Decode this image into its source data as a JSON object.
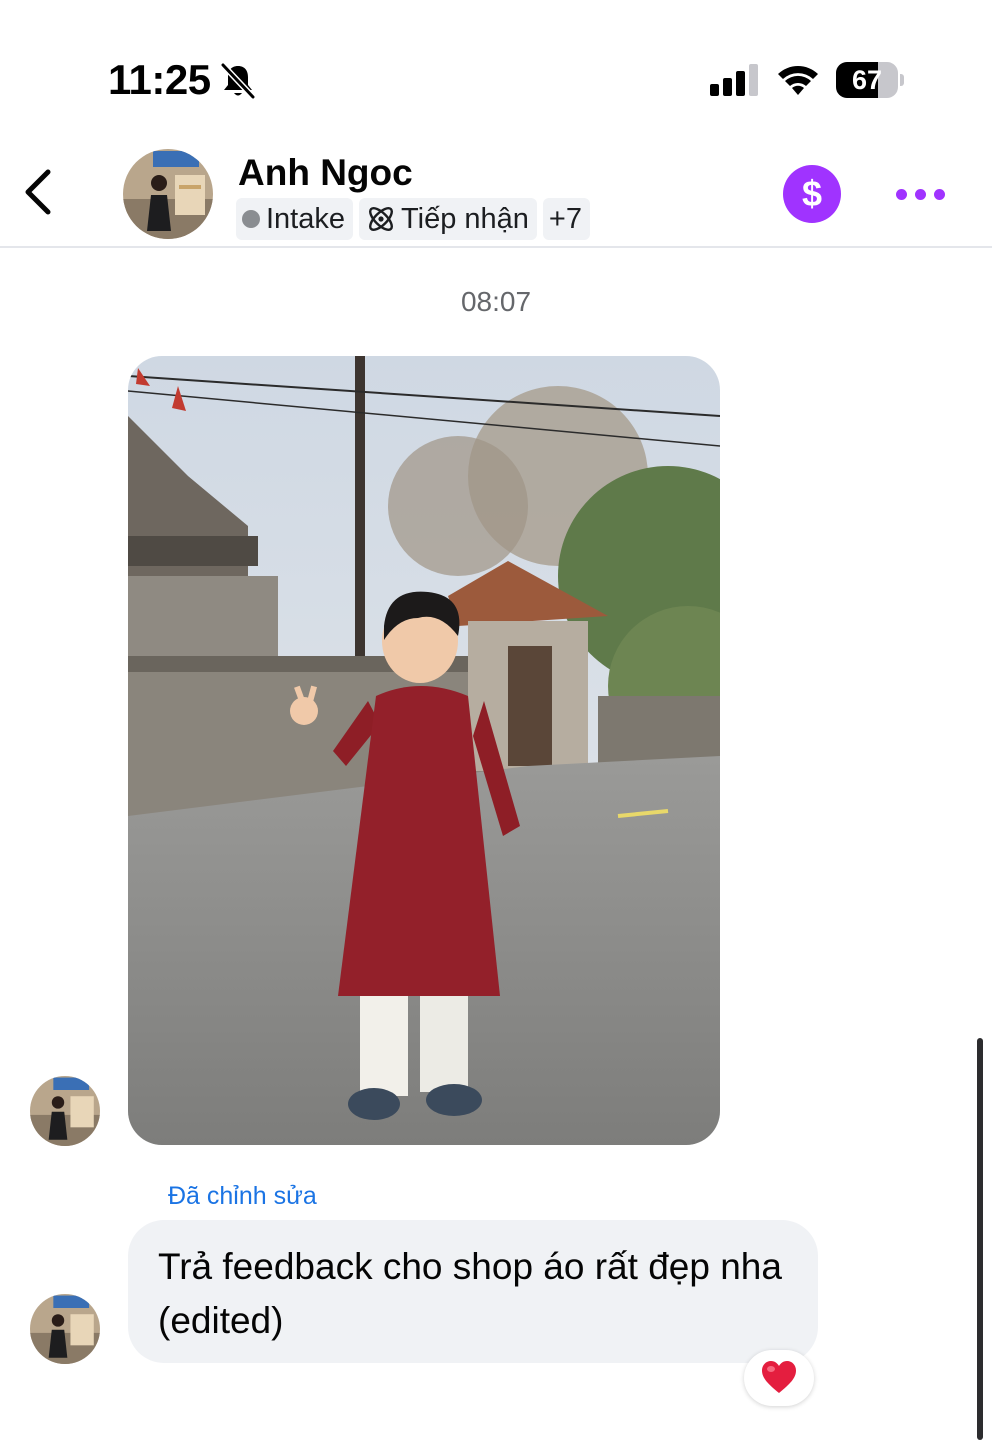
{
  "status_bar": {
    "time": "11:25",
    "battery_level": "67",
    "battery_fraction": 0.67,
    "icons": [
      "bell-slash-icon",
      "cellular-signal-icon",
      "wifi-icon",
      "battery-icon"
    ]
  },
  "header": {
    "contact_name": "Anh Ngoc",
    "tags": [
      {
        "label": "Intake",
        "icon": "gray-dot-icon"
      },
      {
        "label": "Tiếp nhận",
        "icon": "atom-icon"
      },
      {
        "label": "+7"
      }
    ],
    "pay_symbol": "$",
    "icons": [
      "back-chevron-icon",
      "dollar-icon",
      "more-options-icon"
    ]
  },
  "conversation": {
    "timestamp": "08:07",
    "photo_message": {
      "alt": "photo-attachment"
    },
    "edited_label": "Đã chỉnh sửa",
    "text_message": "Trả feedback cho shop áo rất đẹp nha (edited)",
    "reaction": "heart"
  },
  "colors": {
    "accent_purple": "#a033ff",
    "link_blue": "#1b74e4",
    "bubble_gray": "#f0f2f5",
    "muted_text": "#65676b",
    "reaction_red": "#e41e3f"
  }
}
